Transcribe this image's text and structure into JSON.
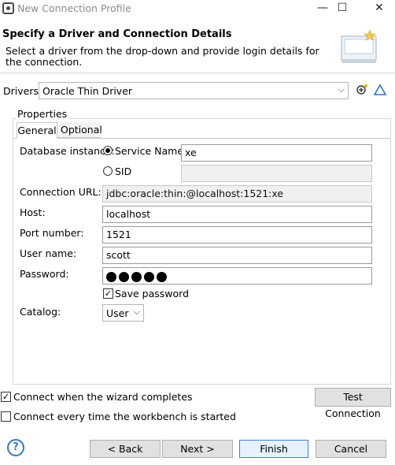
{
  "window": {
    "title": "New Connection Profile",
    "minimize": "—",
    "maximize": "☐",
    "close": "✕"
  },
  "header": {
    "title": "Specify a Driver and Connection Details",
    "description": "Select a driver from the drop-down and provide login details for the connection."
  },
  "drivers": {
    "label": "Drivers:",
    "selected": "Oracle Thin Driver"
  },
  "properties": {
    "group_label": "Properties",
    "tabs": [
      "General",
      "Optional"
    ],
    "database_instance_label": "Database instance:",
    "service_name_label": "Service Name",
    "service_name_value": "xe",
    "sid_label": "SID",
    "sid_value": "",
    "connection_url_label": "Connection URL:",
    "connection_url_value": "jdbc:oracle:thin:@localhost:1521:xe",
    "host_label": "Host:",
    "host_value": "localhost",
    "port_label": "Port number:",
    "port_value": "1521",
    "user_label": "User name:",
    "user_value": "scott",
    "password_label": "Password:",
    "password_length": 5,
    "save_password_label": "Save password",
    "save_password_checked": true,
    "catalog_label": "Catalog:",
    "catalog_selected": "User"
  },
  "options": {
    "connect_on_complete_label": "Connect when the wizard completes",
    "connect_on_complete_checked": true,
    "connect_every_time_label": "Connect every time the workbench is started",
    "connect_every_time_checked": false,
    "test_connection_label": "Test Connection"
  },
  "footer": {
    "help": "?",
    "back": "< Back",
    "next": "Next >",
    "finish": "Finish",
    "cancel": "Cancel"
  },
  "colors": {
    "accent": "#3c7fd8",
    "help_icon": "#3a78c2"
  }
}
